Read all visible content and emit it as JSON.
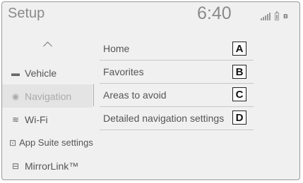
{
  "header": {
    "title": "Setup",
    "clock": "6:40"
  },
  "sidebar": {
    "items": [
      {
        "label": "Vehicle",
        "icon": "car-icon",
        "glyph": "▬"
      },
      {
        "label": "Navigation",
        "icon": "navigation-icon",
        "glyph": "◉",
        "active": true
      },
      {
        "label": "Wi-Fi",
        "icon": "wifi-icon",
        "glyph": "≋"
      },
      {
        "label": "App Suite settings",
        "icon": "app-suite-icon",
        "glyph": "⊡"
      },
      {
        "label": "MirrorLink™",
        "icon": "mirrorlink-icon",
        "glyph": "⊟"
      }
    ]
  },
  "menu": {
    "items": [
      {
        "label": "Home",
        "callout": "A"
      },
      {
        "label": "Favorites",
        "callout": "B"
      },
      {
        "label": "Areas to avoid",
        "callout": "C"
      },
      {
        "label": "Detailed navigation settings",
        "callout": "D"
      }
    ]
  },
  "colors": {
    "screen_bg": "#f0f0f0",
    "active_bg": "#e4e4e4",
    "text": "#555555"
  }
}
